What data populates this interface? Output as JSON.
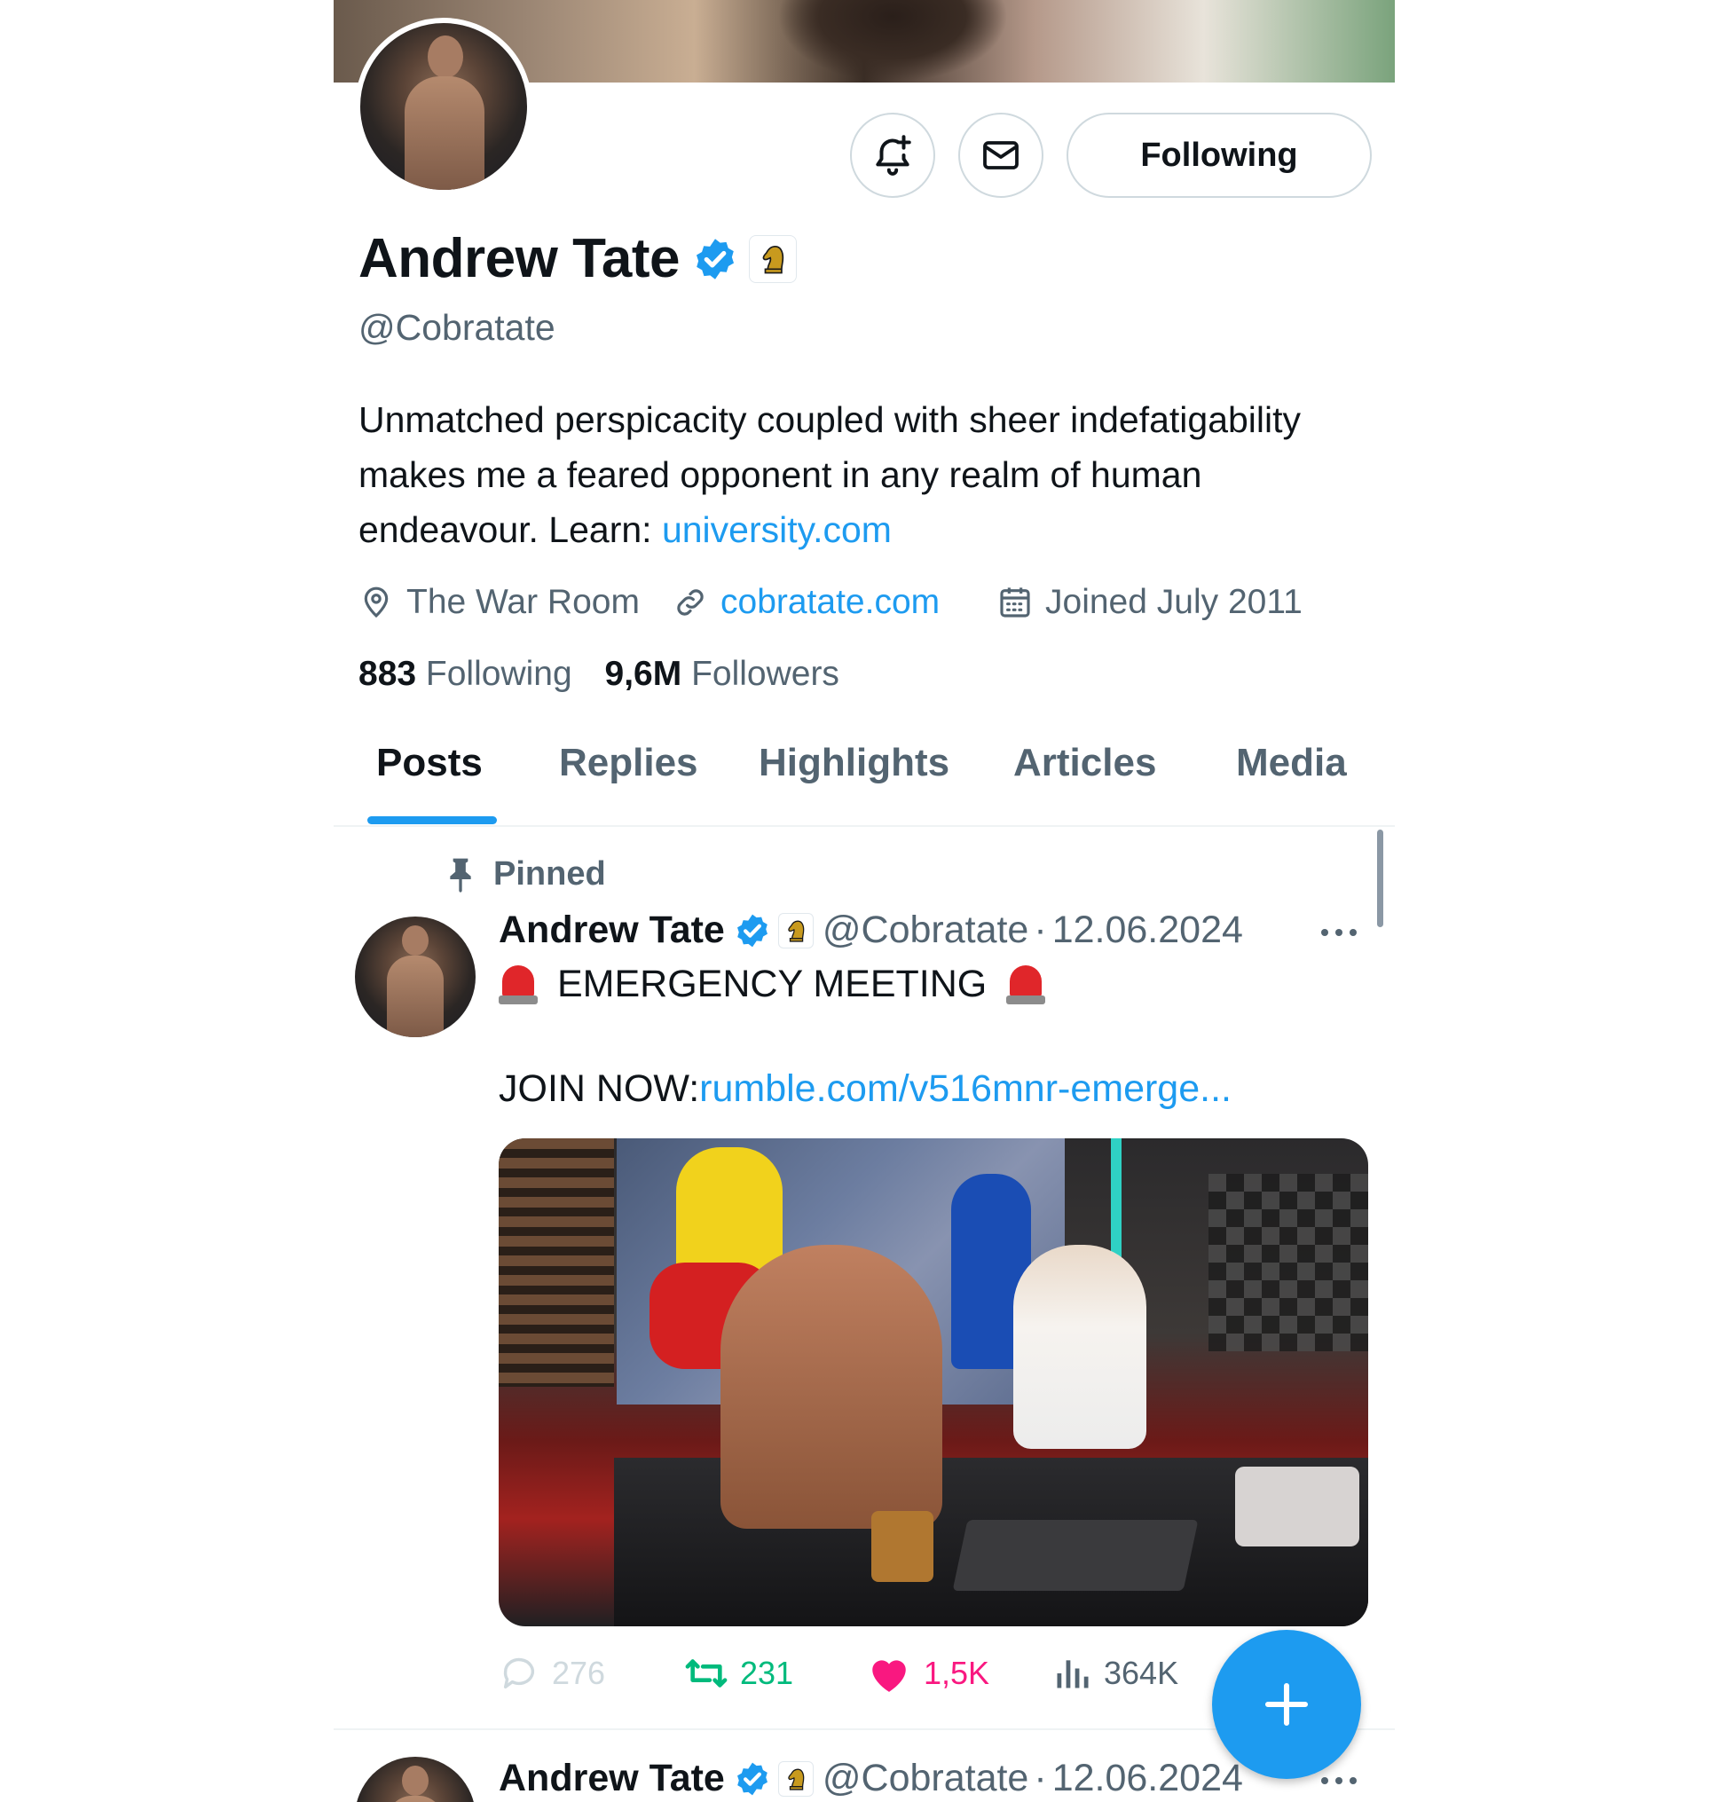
{
  "header": {
    "follow_label": "Following"
  },
  "profile": {
    "name": "Andrew Tate",
    "handle": "@Cobratate",
    "bio_text": "Unmatched perspicacity coupled with sheer indefatigability makes me a feared opponent in any realm of human endeavour. Learn: ",
    "bio_link": "university.com",
    "location": "The War Room",
    "website": "cobratate.com",
    "joined": "Joined July 2011",
    "following_count": "883",
    "following_label": "Following",
    "followers_count": "9,6M",
    "followers_label": "Followers"
  },
  "tabs": [
    {
      "label": "Posts",
      "active": true
    },
    {
      "label": "Replies",
      "active": false
    },
    {
      "label": "Highlights",
      "active": false
    },
    {
      "label": "Articles",
      "active": false
    },
    {
      "label": "Media",
      "active": false
    }
  ],
  "pinned_label": "Pinned",
  "posts": [
    {
      "name": "Andrew Tate",
      "handle": "@Cobratate",
      "sep": "·",
      "date": "12.06.2024",
      "line1": "EMERGENCY MEETING",
      "join_prefix": "JOIN NOW: ",
      "join_link": "rumble.com/v516mnr-emerge...",
      "replies": "276",
      "reposts": "231",
      "likes": "1,5K",
      "views": "364K"
    },
    {
      "name": "Andrew Tate",
      "handle": "@Cobratate",
      "sep": "·",
      "date": "12.06.2024"
    }
  ],
  "icons": {
    "verified": "verified-badge-icon",
    "affiliate": "chess-knight-icon",
    "notify": "bell-plus-icon",
    "message": "envelope-icon",
    "location": "location-pin-icon",
    "link": "link-icon",
    "calendar": "calendar-icon",
    "pin": "pin-icon",
    "more": "more-dots-icon",
    "reply": "reply-icon",
    "repost": "repost-icon",
    "like": "heart-icon",
    "views": "views-chart-icon",
    "compose": "plus-icon"
  },
  "colors": {
    "accent": "#1d9bf0",
    "repost": "#00ba7c",
    "like": "#f91880",
    "secondary_text": "#536471"
  }
}
